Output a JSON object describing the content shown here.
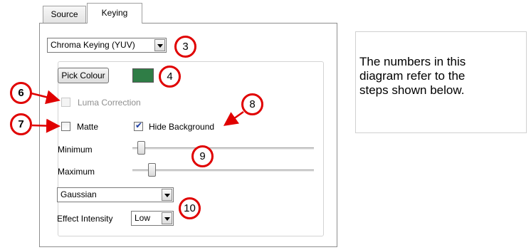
{
  "tabs": [
    {
      "label": "Source",
      "active": false
    },
    {
      "label": "Keying",
      "active": true
    }
  ],
  "keying_mode": {
    "value": "Chroma Keying (YUV)"
  },
  "pick_colour": {
    "label": "Pick Colour",
    "swatch_color": "#2f7d46"
  },
  "luma_correction": {
    "label": "Luma Correction",
    "checked": false,
    "enabled": false
  },
  "matte": {
    "label": "Matte",
    "checked": false
  },
  "hide_background": {
    "label": "Hide Background",
    "checked": true
  },
  "minimum": {
    "label": "Minimum",
    "position": 0.03
  },
  "maximum": {
    "label": "Maximum",
    "position": 0.09
  },
  "blur": {
    "value": "Gaussian"
  },
  "effect_intensity": {
    "label": "Effect Intensity",
    "value": "Low"
  },
  "steps": {
    "s3": "3",
    "s4": "4",
    "s6": "6",
    "s7": "7",
    "s8": "8",
    "s9": "9",
    "s10": "10"
  },
  "note": {
    "text": "The numbers in this\ndiagram refer to the\nsteps shown below."
  },
  "colors": {
    "badge_ring": "#e00000",
    "arrow": "#e00000"
  }
}
